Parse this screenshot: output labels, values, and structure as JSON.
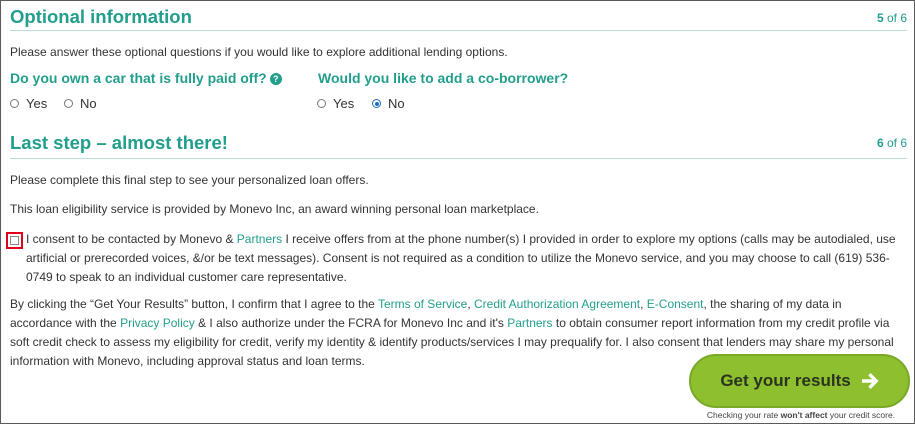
{
  "section5": {
    "title": "Optional information",
    "step_num": "5",
    "step_of": "of 6",
    "intro": "Please answer these optional questions if you would like to explore additional lending options.",
    "q_car": "Do you own a car that is fully paid off?",
    "q_car_help": "?",
    "q_coborrower": "Would you like to add a co-borrower?",
    "opt_yes": "Yes",
    "opt_no": "No",
    "car_selected": null,
    "coborrower_selected": "No"
  },
  "section6": {
    "title": "Last step – almost there!",
    "step_num": "6",
    "step_of": "of 6",
    "para1": "Please complete this final step to see your personalized loan offers.",
    "para2": "This loan eligibility service is provided by Monevo Inc, an award winning personal loan marketplace.",
    "consent_checked": false,
    "consent": {
      "t1": "I consent to be contacted by Monevo & ",
      "link_partners": "Partners",
      "t2": " I receive offers from at the phone number(s) I provided in order to explore my options (calls may be autodialed, use artificial or prerecorded voices, &/or be text messages). Consent is not required as a condition to utilize the Monevo service, and you may choose to call (619) 536-0749 to speak to an individual customer care representative."
    },
    "terms": {
      "t1": "By clicking the “Get Your Results” button, I confirm that I agree to the ",
      "link_tos": "Terms of Service",
      "sep1": ", ",
      "link_credit": "Credit Authorization Agreement",
      "sep2": ", ",
      "link_econsent": "E-Consent",
      "t2": ", the sharing of my data in accordance with the ",
      "link_privacy": "Privacy Policy",
      "t3": " & I also authorize under the FCRA for Monevo Inc and it's ",
      "link_partners": "Partners",
      "t4": " to obtain consumer report information from my credit profile via soft credit check to assess my eligibility for credit, verify my identity & identify products/services I may prequalify for. I also consent that lenders may share my personal information with Monevo, including approval status and loan terms."
    },
    "button_label": "Get your results",
    "button_icon": "arrow-right-icon",
    "note_pre": "Checking your rate ",
    "note_bold": "won't affect",
    "note_post": " your credit score."
  },
  "colors": {
    "accent_teal": "#229e8c",
    "button_green": "#8dbf2e",
    "highlight_red": "#e0001b",
    "radio_blue": "#1b6ec2"
  }
}
